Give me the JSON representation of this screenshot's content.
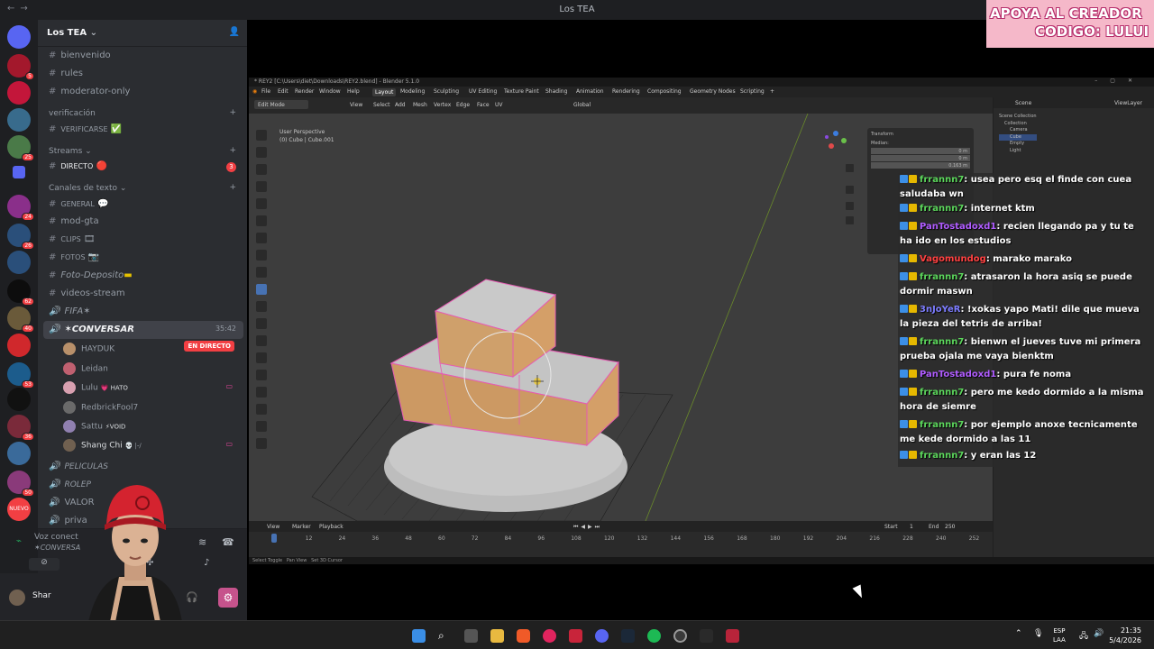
{
  "window": {
    "title": "Los TEA"
  },
  "banner": {
    "line1": "APOYA AL CREADOR",
    "line2": "CODIGO: LULUI"
  },
  "discord": {
    "server_name": "Los TEA",
    "server_badges": [
      "5",
      "",
      "",
      "25",
      "",
      "24",
      "26",
      "",
      "62",
      "40",
      "",
      "53",
      "",
      "36",
      "",
      "50",
      "",
      "NUEVO"
    ],
    "channels": [
      {
        "type": "text",
        "label": "bienvenido"
      },
      {
        "type": "text",
        "label": "rules"
      },
      {
        "type": "text",
        "label": "moderator-only"
      },
      {
        "type": "category",
        "label": "verificación"
      },
      {
        "type": "text",
        "label": "VERIFICARSE",
        "suffix": "✅"
      },
      {
        "type": "category",
        "label": "Streams"
      },
      {
        "type": "text",
        "label": "DIRECTO",
        "suffix": "🔴",
        "badge": "3"
      },
      {
        "type": "category",
        "label": "Canales de texto"
      },
      {
        "type": "text",
        "label": "GENERAL",
        "suffix": "💬"
      },
      {
        "type": "text",
        "label": "mod-gta"
      },
      {
        "type": "text",
        "label": "CLIPS",
        "suffix": "🎞"
      },
      {
        "type": "text",
        "label": "FOTOS",
        "suffix": "📷"
      },
      {
        "type": "text",
        "label": "Foto-Deposito",
        "suffix": "▬"
      },
      {
        "type": "text",
        "label": "videos-stream"
      },
      {
        "type": "voice",
        "label": "FIFA✶"
      },
      {
        "type": "voice",
        "label": "✶CONVERSAR",
        "time": "35:42"
      }
    ],
    "voice_users": [
      {
        "name": "HAYDUK",
        "live": "EN DIRECTO",
        "color": "#b8906a"
      },
      {
        "name": "Leidan",
        "color": "#c06070"
      },
      {
        "name": "Lulu",
        "tag": "💗 HATO",
        "color": "#d8a0b0"
      },
      {
        "name": "RedbrickFool7",
        "color": "#6a6a6a"
      },
      {
        "name": "Sattu",
        "tag": "⚡VOID",
        "color": "#9080b0"
      },
      {
        "name": "Shang Chi",
        "tag": "💀 |-/",
        "color": "#706050"
      }
    ],
    "more_channels": [
      {
        "type": "voice",
        "label": "PELICULAS"
      },
      {
        "type": "voice",
        "label": "ROLEP"
      },
      {
        "type": "voice",
        "label": "VALOR"
      },
      {
        "type": "voice",
        "label": "priva"
      }
    ],
    "voice_connected": {
      "status": "Voz conect",
      "channel": "✶CONVERSA"
    },
    "user": {
      "name": "Shar"
    }
  },
  "blender": {
    "title": "* REY2 [C:\\Users\\diet\\Downloads\\REY2.blend] - Blender 5.1.0",
    "menus": [
      "File",
      "Edit",
      "Render",
      "Window",
      "Help"
    ],
    "workspaces": [
      "Layout",
      "Modeling",
      "Sculpting",
      "UV Editing",
      "Texture Paint",
      "Shading",
      "Animation",
      "Rendering",
      "Compositing",
      "Geometry Nodes",
      "Scripting"
    ],
    "active_workspace": "Layout",
    "mode": "Edit Mode",
    "view_menus": [
      "View",
      "Select",
      "Add",
      "Mesh",
      "Vertex",
      "Edge",
      "Face",
      "UV"
    ],
    "orientation": "Global",
    "viewport_info": {
      "line1": "User Perspective",
      "line2": "(0) Cube | Cube.001"
    },
    "timeline": {
      "menus": [
        "Playback"
      ],
      "frames": [
        "0",
        "12",
        "24",
        "36",
        "48",
        "60",
        "72",
        "84",
        "96",
        "108",
        "120",
        "132",
        "144",
        "156",
        "168",
        "180",
        "192",
        "204",
        "216",
        "228",
        "240",
        "252"
      ],
      "start_label": "Start",
      "start": "1",
      "end_label": "End",
      "end": "250"
    },
    "outliner": {
      "header": "Scene",
      "view_layer": "ViewLayer",
      "items": [
        "Scene Collection",
        "Collection",
        "Camera",
        "Cube",
        "Empty",
        "Light"
      ]
    },
    "n_panel": {
      "title": "Transform",
      "median": "Median:",
      "x": "0 m",
      "y": "0 m",
      "z": "0.163 m"
    }
  },
  "chat": [
    {
      "user": "frrannn7",
      "text": ": usea    pero esq el finde con cuea saludaba wn",
      "color": "#5cd65c"
    },
    {
      "user": "frrannn7",
      "text": ": internet ktm",
      "color": "#5cd65c"
    },
    {
      "user": "PanTostadoxd1",
      "text": ": recien llegando pa y tu       te ha ido en los estudios",
      "color": "#b05cff"
    },
    {
      "user": "Vagomundog",
      "text": ": marako marako",
      "color": "#ff4040"
    },
    {
      "user": "frrannn7",
      "text": ": atrasaron la hora asiq se puede dormir maswn",
      "color": "#5cd65c"
    },
    {
      "user": "3nJoYeR",
      "text": ": !xokas yapo Mati! dile que mueva la pieza del tetris de arriba!",
      "color": "#7d7dff"
    },
    {
      "user": "frrannn7",
      "text": ": bienwn el jueves tuve mi primera prueba ojala me vaya bienktm",
      "color": "#5cd65c"
    },
    {
      "user": "PanTostadoxd1",
      "text": ": pura fe noma",
      "color": "#b05cff"
    },
    {
      "user": "frrannn7",
      "text": ": pero      me kedo dormido a la misma hora de siemre",
      "color": "#5cd65c"
    },
    {
      "user": "frrannn7",
      "text": ": por ejemplo anoxe tecnicamente me kede dormido a las 11",
      "color": "#5cd65c"
    },
    {
      "user": "frrannn7",
      "text": ": y eran las 12",
      "color": "#5cd65c"
    }
  ],
  "taskbar": {
    "lang1": "ESP",
    "lang2": "LAA",
    "time": "21:35",
    "date": "5/4/2026"
  }
}
